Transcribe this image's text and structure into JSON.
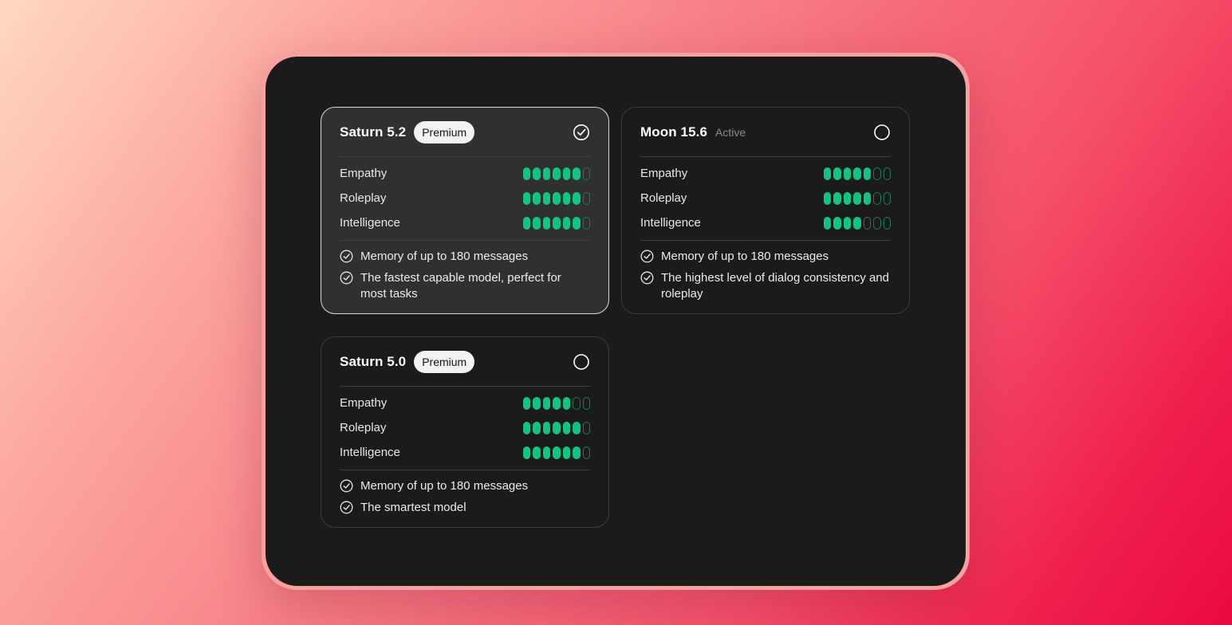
{
  "colors": {
    "accent_green": "#13c384",
    "card_bg": "#1b1b1b",
    "selected_card_bg": "#303030"
  },
  "cards": [
    {
      "title": "Saturn 5.2",
      "badge": "Premium",
      "status": "",
      "selected": true,
      "ratings": [
        {
          "label": "Empathy",
          "filled": 6,
          "total": 7
        },
        {
          "label": "Roleplay",
          "filled": 6,
          "total": 7
        },
        {
          "label": "Intelligence",
          "filled": 6,
          "total": 7
        }
      ],
      "features": [
        "Memory of up to 180 messages",
        "The fastest capable model, perfect for most tasks"
      ]
    },
    {
      "title": "Moon 15.6",
      "badge": "",
      "status": "Active",
      "selected": false,
      "ratings": [
        {
          "label": "Empathy",
          "filled": 5,
          "total": 7
        },
        {
          "label": "Roleplay",
          "filled": 5,
          "total": 7
        },
        {
          "label": "Intelligence",
          "filled": 4,
          "total": 7
        }
      ],
      "features": [
        "Memory of up to 180 messages",
        "The highest level of dialog consistency and roleplay"
      ]
    },
    {
      "title": "Saturn 5.0",
      "badge": "Premium",
      "status": "",
      "selected": false,
      "ratings": [
        {
          "label": "Empathy",
          "filled": 5,
          "total": 7
        },
        {
          "label": "Roleplay",
          "filled": 6,
          "total": 7
        },
        {
          "label": "Intelligence",
          "filled": 6,
          "total": 7
        }
      ],
      "features": [
        "Memory of up to 180 messages",
        "The smartest model"
      ]
    }
  ]
}
